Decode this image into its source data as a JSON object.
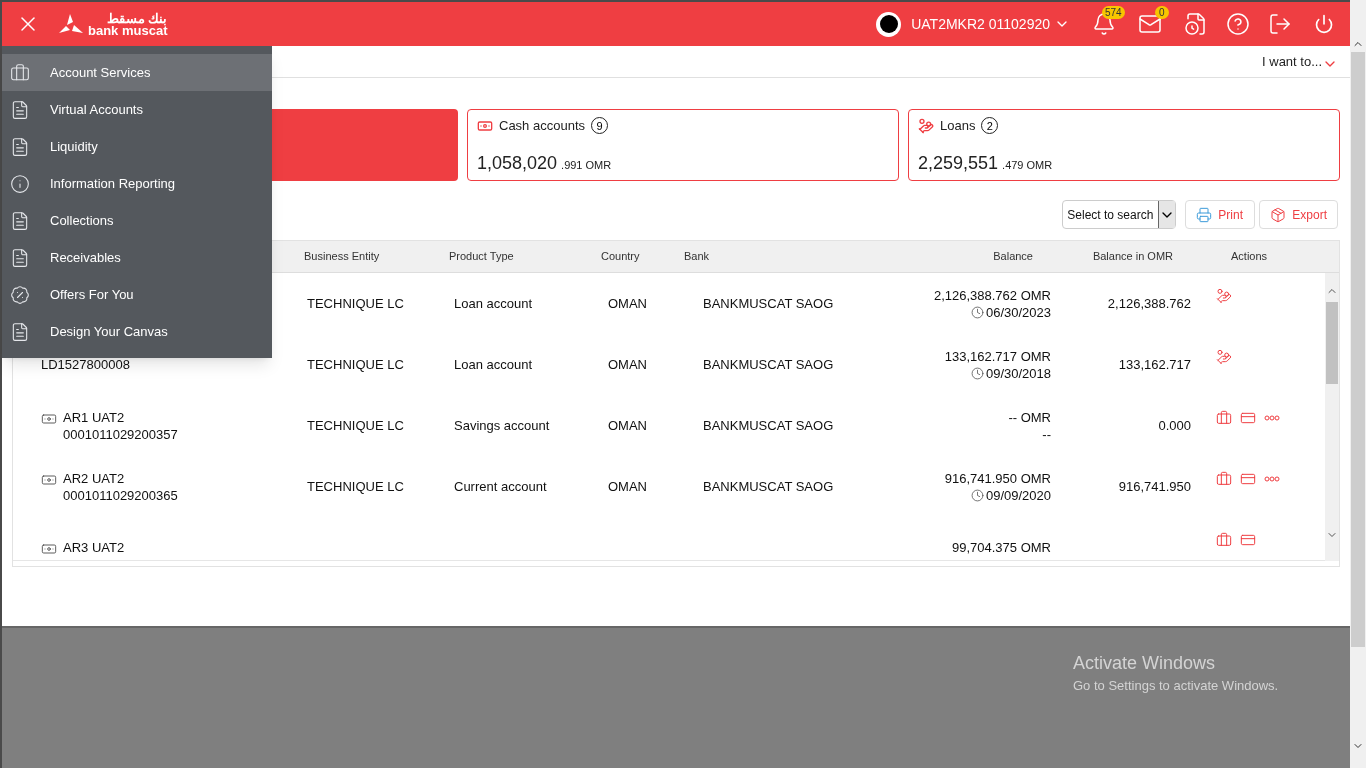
{
  "header": {
    "logo": {
      "arabic": "بنك مسقط",
      "latin": "bank muscat"
    },
    "user": "UAT2MKR2 01102920",
    "notifications_badge": "574",
    "messages_badge": "0"
  },
  "subheader": {
    "menu_label": "I want to..."
  },
  "menu": [
    {
      "label": "Account Services",
      "kind": "briefcase",
      "selected": true
    },
    {
      "label": "Virtual Accounts",
      "kind": "document",
      "selected": false
    },
    {
      "label": "Liquidity",
      "kind": "document",
      "selected": false
    },
    {
      "label": "Information Reporting",
      "kind": "info",
      "selected": false
    },
    {
      "label": "Collections",
      "kind": "document",
      "selected": false
    },
    {
      "label": "Receivables",
      "kind": "document",
      "selected": false
    },
    {
      "label": "Offers For You",
      "kind": "percent",
      "selected": false
    },
    {
      "label": "Design Your Canvas",
      "kind": "document",
      "selected": false
    }
  ],
  "summary_cards": [
    {
      "kind": "filled"
    },
    {
      "kind": "cash",
      "title": "Cash accounts",
      "count": "9",
      "amount": "1,058,020",
      "decimals": ".991 OMR"
    },
    {
      "kind": "loan",
      "title": "Loans",
      "count": "2",
      "amount": "2,259,551",
      "decimals": ".479 OMR"
    }
  ],
  "toolbar": {
    "search_select": "Select to search",
    "buttons": [
      {
        "kind": "print",
        "label": "Print"
      },
      {
        "kind": "export",
        "label": "Export"
      }
    ]
  },
  "table": {
    "columns": [
      "Business Entity",
      "Product Type",
      "Country",
      "Bank",
      "Balance",
      "Balance in OMR",
      "Actions"
    ],
    "rows": [
      {
        "entity": "TECHNIQUE LC",
        "product": "Loan account",
        "country": "OMAN",
        "bank": "BANKMUSCAT SAOG",
        "balance": "2,126,388.762 OMR",
        "balance_date": "06/30/2023",
        "date_icon": true,
        "balance_omr": "2,126,388.762",
        "actions": [
          {
            "kind": "loan"
          }
        ]
      },
      {
        "account_number": "LD1527800008",
        "entity": "TECHNIQUE LC",
        "product": "Loan account",
        "country": "OMAN",
        "bank": "BANKMUSCAT SAOG",
        "balance": "133,162.717 OMR",
        "balance_date": "09/30/2018",
        "date_icon": true,
        "balance_omr": "133,162.717",
        "actions": [
          {
            "kind": "loan"
          }
        ]
      },
      {
        "account_name": "AR1 UAT2",
        "account_number": "0001011029200357",
        "entity": "TECHNIQUE LC",
        "product": "Savings account",
        "country": "OMAN",
        "bank": "BANKMUSCAT SAOG",
        "balance": "-- OMR",
        "balance_date": "--",
        "date_icon": false,
        "balance_omr": "0.000",
        "actions": [
          {
            "kind": "briefcase"
          },
          {
            "kind": "statement"
          },
          {
            "kind": "more"
          }
        ]
      },
      {
        "account_name": "AR2 UAT2",
        "account_number": "0001011029200365",
        "entity": "TECHNIQUE LC",
        "product": "Current account",
        "country": "OMAN",
        "bank": "BANKMUSCAT SAOG",
        "balance": "916,741.950 OMR",
        "balance_date": "09/09/2020",
        "date_icon": true,
        "balance_omr": "916,741.950",
        "actions": [
          {
            "kind": "briefcase"
          },
          {
            "kind": "statement"
          },
          {
            "kind": "more"
          }
        ]
      },
      {
        "account_name": "AR3 UAT2",
        "balance": "99,704.375 OMR",
        "actions": [
          {
            "kind": "briefcase"
          },
          {
            "kind": "statement"
          }
        ]
      }
    ]
  },
  "windows_notice": {
    "title": "Activate Windows",
    "subtitle": "Go to Settings to activate Windows."
  }
}
